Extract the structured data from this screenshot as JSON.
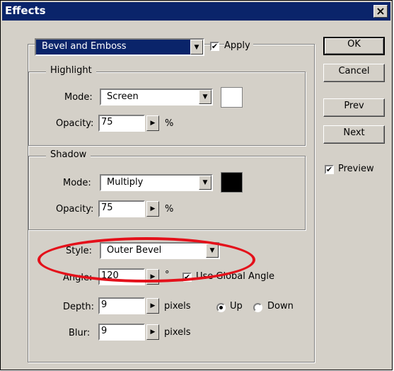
{
  "window": {
    "title": "Effects",
    "close_glyph": "×"
  },
  "effect_select": {
    "value": "Bevel and Emboss"
  },
  "apply": {
    "label": "Apply",
    "checked": true
  },
  "highlight": {
    "title": "Highlight",
    "mode_label": "Mode:",
    "mode_value": "Screen",
    "opacity_label": "Opacity:",
    "opacity_value": "75",
    "unit": "%",
    "color": "#ffffff"
  },
  "shadow": {
    "title": "Shadow",
    "mode_label": "Mode:",
    "mode_value": "Multiply",
    "opacity_label": "Opacity:",
    "opacity_value": "75",
    "unit": "%",
    "color": "#000000"
  },
  "style": {
    "label": "Style:",
    "value": "Outer Bevel"
  },
  "angle": {
    "label": "Angle:",
    "value": "120",
    "unit": "°",
    "global_label": "Use Global Angle",
    "global_checked": true
  },
  "depth": {
    "label": "Depth:",
    "value": "9",
    "unit": "pixels"
  },
  "direction": {
    "up_label": "Up",
    "down_label": "Down",
    "selected": "Up"
  },
  "blur": {
    "label": "Blur:",
    "value": "9",
    "unit": "pixels"
  },
  "buttons": {
    "ok": "OK",
    "cancel": "Cancel",
    "prev": "Prev",
    "next": "Next"
  },
  "preview": {
    "label": "Preview",
    "checked": true
  },
  "colors": {
    "title_bar": "#0a246a",
    "dialog_bg": "#d4d0c8",
    "highlight_ellipse": "#e4101a"
  }
}
